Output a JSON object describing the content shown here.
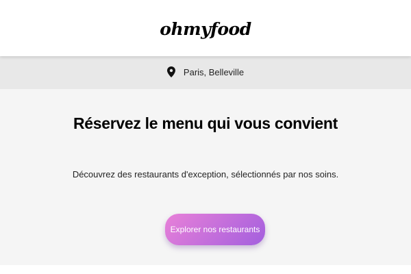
{
  "header": {
    "logo": "ohmyfood"
  },
  "location": {
    "icon": "map-pin-icon",
    "text": "Paris, Belleville"
  },
  "main": {
    "headline": "Réservez le menu qui vous convient",
    "subtext": "Découvrez des restaurants d'exception, sélectionnés par nos soins.",
    "cta_label": "Explorer nos restaurants"
  },
  "colors": {
    "button_gradient_start": "#e880d8",
    "button_gradient_end": "#a35fde",
    "location_bar_bg": "#e8e8e8",
    "main_bg": "#f5f5f5"
  }
}
